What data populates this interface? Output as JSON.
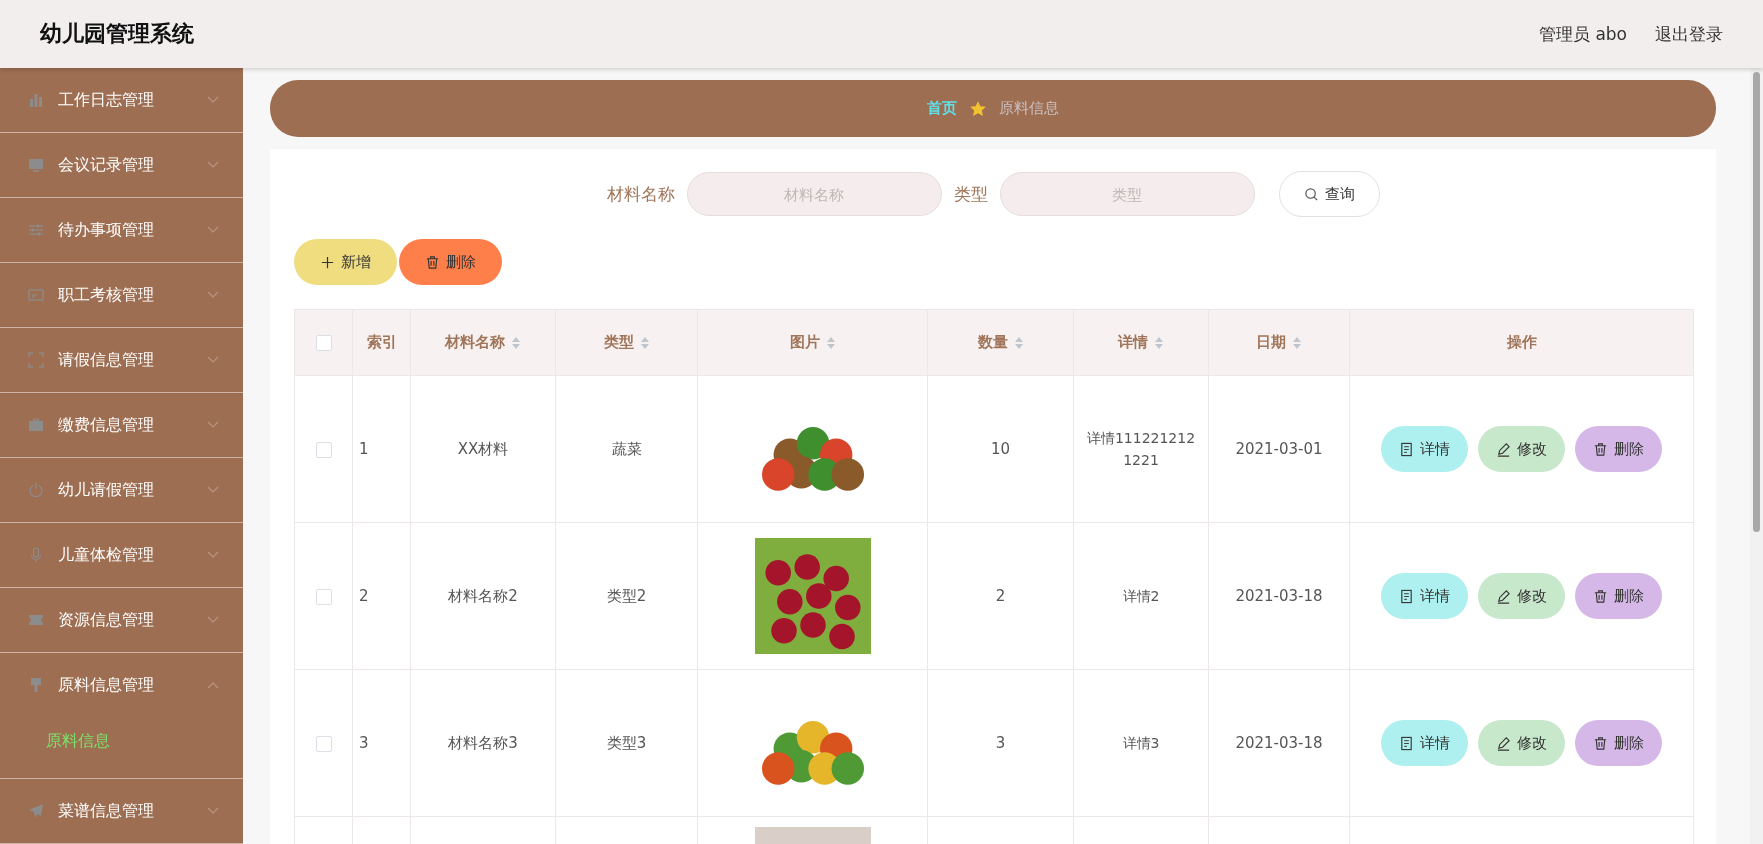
{
  "header": {
    "title": "幼儿园管理系统",
    "user": "管理员 abo",
    "logout": "退出登录"
  },
  "sidebar": {
    "items": [
      {
        "label": "工作日志管理",
        "expanded": false
      },
      {
        "label": "会议记录管理",
        "expanded": false
      },
      {
        "label": "待办事项管理",
        "expanded": false
      },
      {
        "label": "职工考核管理",
        "expanded": false
      },
      {
        "label": "请假信息管理",
        "expanded": false
      },
      {
        "label": "缴费信息管理",
        "expanded": false
      },
      {
        "label": "幼儿请假管理",
        "expanded": false
      },
      {
        "label": "儿童体检管理",
        "expanded": false
      },
      {
        "label": "资源信息管理",
        "expanded": false
      },
      {
        "label": "原料信息管理",
        "expanded": true,
        "children": [
          {
            "label": "原料信息",
            "selected": true
          }
        ]
      },
      {
        "label": "菜谱信息管理",
        "expanded": false
      }
    ]
  },
  "breadcrumb": [
    {
      "label": "首页",
      "selected": true
    },
    {
      "label": "原料信息",
      "selected": false
    }
  ],
  "search": {
    "fields": [
      {
        "label": "材料名称",
        "placeholder": "材料名称"
      },
      {
        "label": "类型",
        "placeholder": "类型"
      }
    ],
    "button": "查询"
  },
  "actions": [
    {
      "kind": "add",
      "label": "新增"
    },
    {
      "kind": "delete",
      "label": "删除"
    }
  ],
  "table": {
    "select_all": {
      "checked": false
    },
    "columns": [
      {
        "label": "索引",
        "sortable": false
      },
      {
        "label": "材料名称",
        "sortable": true
      },
      {
        "label": "类型",
        "sortable": true
      },
      {
        "label": "图片",
        "sortable": true
      },
      {
        "label": "数量",
        "sortable": true
      },
      {
        "label": "详情",
        "sortable": true
      },
      {
        "label": "日期",
        "sortable": true
      },
      {
        "label": "操作",
        "sortable": false
      }
    ],
    "rows": [
      {
        "checked": false,
        "index": "1",
        "name": "XX材料",
        "type": "蔬菜",
        "quantity": "10",
        "detail": "详情111221212 1221",
        "date": "2021-03-01",
        "buttons": [
          {
            "kind": "detail",
            "label": "详情"
          },
          {
            "kind": "edit",
            "label": "修改"
          },
          {
            "kind": "delete",
            "label": "删除"
          }
        ]
      },
      {
        "checked": false,
        "index": "2",
        "name": "材料名称2",
        "type": "类型2",
        "quantity": "2",
        "detail": "详情2",
        "date": "2021-03-18",
        "buttons": [
          {
            "kind": "detail",
            "label": "详情"
          },
          {
            "kind": "edit",
            "label": "修改"
          },
          {
            "kind": "delete",
            "label": "删除"
          }
        ]
      },
      {
        "checked": false,
        "index": "3",
        "name": "材料名称3",
        "type": "类型3",
        "quantity": "3",
        "detail": "详情3",
        "date": "2021-03-18",
        "buttons": [
          {
            "kind": "detail",
            "label": "详情"
          },
          {
            "kind": "edit",
            "label": "修改"
          },
          {
            "kind": "delete",
            "label": "删除"
          }
        ]
      }
    ]
  }
}
